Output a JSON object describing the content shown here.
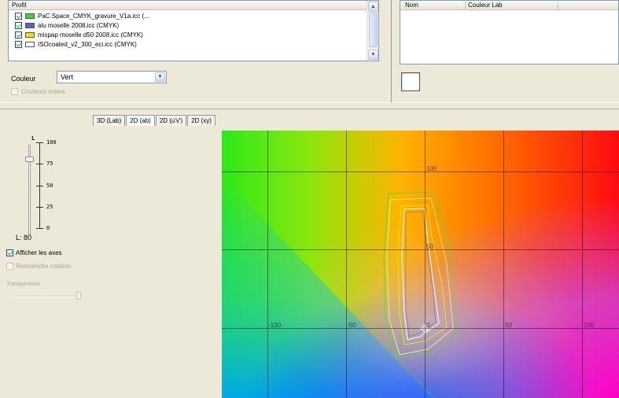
{
  "profiles": {
    "header": "Profil",
    "items": [
      {
        "label": "PaC.Space_CMYK_gravure_V1a.icc (...",
        "color": "#39d639",
        "checked": true
      },
      {
        "label": "alu moselle 2008.icc (CMYK)",
        "color": "#5a5bd6",
        "checked": true
      },
      {
        "label": "mixpap moselle d50 2008.icc (CMYK)",
        "color": "#f5e000",
        "checked": true
      },
      {
        "label": "ISOcoated_v2_300_eci.icc (CMYK)",
        "color": "#ffffff",
        "checked": true
      }
    ]
  },
  "color_select": {
    "label": "Couleur",
    "value": "Vert"
  },
  "true_colors": {
    "label": "Couleurs vraies",
    "checked": false
  },
  "named_colors_table": {
    "col_name": "Nom",
    "col_lab": "Couleur Lab"
  },
  "lightness": {
    "title": "L",
    "ticks": [
      "100",
      "75",
      "50",
      "25",
      "0"
    ],
    "value_label": "L: 80",
    "value": 80
  },
  "show_axes": {
    "label": "Afficher les axes",
    "checked": true
  },
  "restrict_rotation": {
    "label": "Restreindre rotation",
    "checked": false
  },
  "transparency": {
    "label": "Transparence",
    "value": 1.0
  },
  "tabs": [
    "3D (Lab)",
    "2D (ab)",
    "2D (u'v')",
    "2D (xy)"
  ],
  "active_tab": 1,
  "plot_labels": {
    "top": "100",
    "mid": "50",
    "left_far": "-100",
    "left": "-50",
    "origin": "0",
    "right": "50",
    "right_far": "100"
  },
  "colors": {
    "gamut_green": "#5fd35a",
    "gamut_blue": "#5a5bd6",
    "gamut_yellow": "#f5e000",
    "gamut_white": "#ffffff"
  }
}
